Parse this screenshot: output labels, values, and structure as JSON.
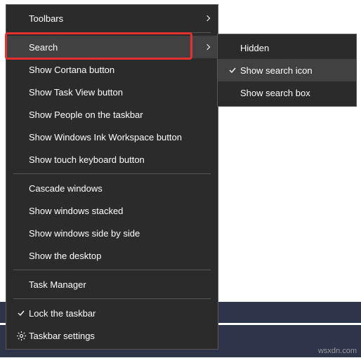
{
  "menu": {
    "toolbars": "Toolbars",
    "search": "Search",
    "show_cortana": "Show Cortana button",
    "show_task_view": "Show Task View button",
    "show_people": "Show People on the taskbar",
    "show_ink": "Show Windows Ink Workspace button",
    "show_touch_kb": "Show touch keyboard button",
    "cascade": "Cascade windows",
    "stacked": "Show windows stacked",
    "side_by_side": "Show windows side by side",
    "desktop": "Show the desktop",
    "task_manager": "Task Manager",
    "lock_taskbar": "Lock the taskbar",
    "taskbar_settings": "Taskbar settings"
  },
  "submenu": {
    "hidden": "Hidden",
    "show_icon": "Show search icon",
    "show_box": "Show search box"
  },
  "watermark": "wsxdn.com"
}
